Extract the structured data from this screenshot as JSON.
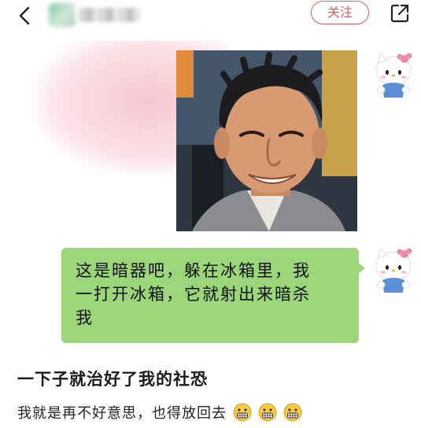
{
  "header": {
    "follow_label": "关注"
  },
  "chat": {
    "bubble_lines": [
      "这是暗器吧，躲在冰箱里，我",
      "一打开冰箱，它就射出来暗杀",
      "我"
    ],
    "bubble_color": "#9bd67a"
  },
  "caption": {
    "title": "一下子就治好了我的社恐",
    "body": "我就是再不好意思，也得放回去"
  },
  "icons": {
    "back": "chevron-left-icon",
    "share": "share-out-icon",
    "avatar": "hello-kitty-icon",
    "emoji": "grimacing-face-icon"
  },
  "colors": {
    "accent": "#e05a5a",
    "bubble": "#9bd67a"
  }
}
